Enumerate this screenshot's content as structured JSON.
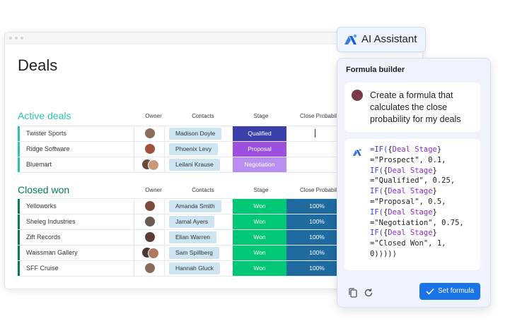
{
  "board": {
    "title": "Deals",
    "columns": {
      "owner": "Owner",
      "contacts": "Contacts",
      "stage": "Stage",
      "close_probability": "Close Probability"
    },
    "active": {
      "title": "Active deals",
      "accent": "#2bc4b4",
      "rows": [
        {
          "name": "Twister Sports",
          "contact": "Madison Doyle",
          "stage": "Qualified",
          "stage_color": "#3b3fa8",
          "prob": ""
        },
        {
          "name": "Ridge Software",
          "contact": "Phoenix Levy",
          "stage": "Proposal",
          "stage_color": "#9d50dd",
          "prob": ""
        },
        {
          "name": "Bluemart",
          "contact": "Leilani Krause",
          "stage": "Negotiation",
          "stage_color": "#b88ff0",
          "prob": ""
        }
      ]
    },
    "closed": {
      "title": "Closed won",
      "accent": "#037f4c",
      "rows": [
        {
          "name": "Yelloworks",
          "contact": "Amanda Smith",
          "stage": "Won",
          "prob": "100%"
        },
        {
          "name": "Sheleg Industries",
          "contact": "Jamal Ayers",
          "stage": "Won",
          "prob": "100%"
        },
        {
          "name": "Zift Records",
          "contact": "Elian Warren",
          "stage": "Won",
          "prob": "100%"
        },
        {
          "name": "Waissman Gallery",
          "contact": "Sam Spillberg",
          "stage": "Won",
          "prob": "100%"
        },
        {
          "name": "SFF Cruise",
          "contact": "Hannah Gluck",
          "stage": "Won",
          "prob": "100%"
        }
      ],
      "stage_color": "#00c875",
      "prob_color": "#1f6ba0"
    }
  },
  "assistant": {
    "button_label": "AI Assistant",
    "panel_title": "Formula builder",
    "prompt": "Create a formula that calculates the close probability for my deals",
    "set_button": "Set formula"
  }
}
